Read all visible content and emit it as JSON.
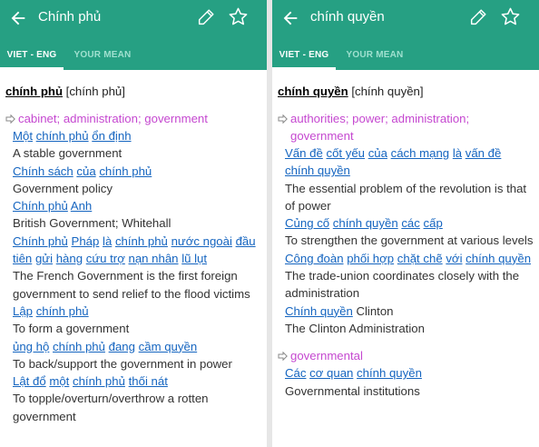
{
  "left": {
    "title": "Chính phủ",
    "tabs": [
      "VIET - ENG",
      "YOUR MEAN"
    ],
    "headword": "chính phủ",
    "headword_bracket": "[chính phủ]",
    "sense": "cabinet; administration; government",
    "examples": [
      {
        "vi": [
          "Một",
          "chính phủ",
          "ổn định"
        ],
        "en": "A stable government"
      },
      {
        "vi": [
          "Chính sách",
          "của",
          "chính phủ"
        ],
        "en": "Government policy"
      },
      {
        "vi": [
          "Chính phủ",
          "Anh"
        ],
        "en": "British Government; Whitehall"
      },
      {
        "vi": [
          "Chính phủ",
          "Pháp",
          "là",
          "chính phủ",
          "nước ngoài",
          "đầu tiên",
          "gửi",
          "hàng",
          "cứu trợ",
          "nạn nhân",
          "lũ lụt"
        ],
        "en": "The French Government is the first foreign government to send relief to the flood victims"
      },
      {
        "vi": [
          "Lập",
          "chính phủ"
        ],
        "en": "To form a government"
      },
      {
        "vi": [
          "ủng hộ",
          "chính phủ",
          "đang",
          "cầm quyền"
        ],
        "en": "To back/support the government in power"
      },
      {
        "vi": [
          "Lật đổ",
          "một",
          "chính phủ",
          "thối nát"
        ],
        "en": "To topple/overturn/overthrow a rotten government"
      }
    ]
  },
  "right": {
    "title": "chính quyền",
    "tabs": [
      "VIET - ENG",
      "YOUR MEAN"
    ],
    "headword": "chính quyền",
    "headword_bracket": "[chính quyền]",
    "sense": "authorities; power; administration; government",
    "examples": [
      {
        "vi": [
          "Vấn đề",
          "cốt yếu",
          "của",
          "cách mạng",
          "là",
          "vấn đề",
          "chính quyền"
        ],
        "en": "The essential problem of the revolution is that of power"
      },
      {
        "vi": [
          "Củng cố",
          "chính quyền",
          "các",
          "cấp"
        ],
        "en": "To strengthen the government at various levels"
      },
      {
        "vi": [
          "Công đoàn",
          "phối hợp",
          "chặt chẽ",
          "với",
          "chính quyền"
        ],
        "en": "The trade-union coordinates closely with the administration"
      },
      {
        "vi": [
          "Chính quyền"
        ],
        "vi_plain": "Clinton",
        "en": "The Clinton Administration"
      }
    ],
    "sense2": "governmental",
    "examples2": [
      {
        "vi": [
          "Các",
          "cơ quan",
          "chính quyền"
        ],
        "en": "Governmental institutions"
      }
    ]
  },
  "colors": {
    "appbar": "#26a083",
    "sense": "#c548d0",
    "link": "#1565c0"
  },
  "icons": [
    "back-arrow-icon",
    "pencil-icon",
    "star-icon",
    "sense-arrow-icon"
  ]
}
